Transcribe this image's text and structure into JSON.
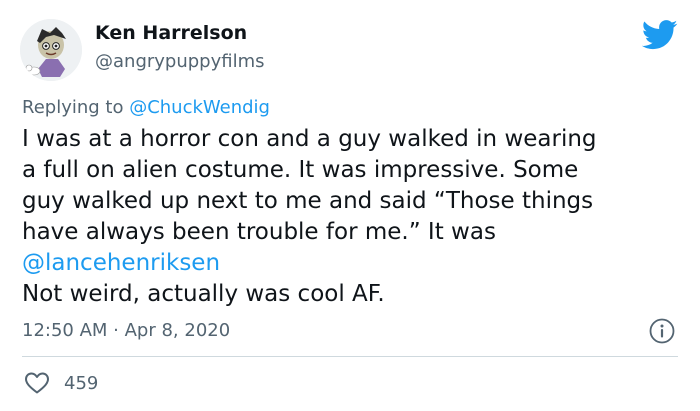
{
  "author": {
    "name": "Ken Harrelson",
    "handle": "@angrypuppyfilms"
  },
  "reply": {
    "prefix": "Replying to ",
    "mention": "@ChuckWendig"
  },
  "tweet": {
    "lines": [
      "I was at a horror con and a guy walked in wearing",
      "a full on alien costume. It was impressive. Some",
      "guy walked up next to me and said “Those things",
      "have always been trouble for me.” It was"
    ],
    "mention": "@lancehenriksen",
    "last_line": "Not weird, actually was cool AF."
  },
  "meta": {
    "timestamp": "12:50 AM · Apr 8, 2020"
  },
  "likes": {
    "count": "459"
  },
  "icons": {
    "brand": "twitter-bird-icon",
    "info": "info-icon",
    "like": "heart-icon"
  },
  "colors": {
    "brand": "#1d9bf0",
    "text": "#0f1419",
    "muted": "#536471",
    "divider": "#cfd9de"
  }
}
